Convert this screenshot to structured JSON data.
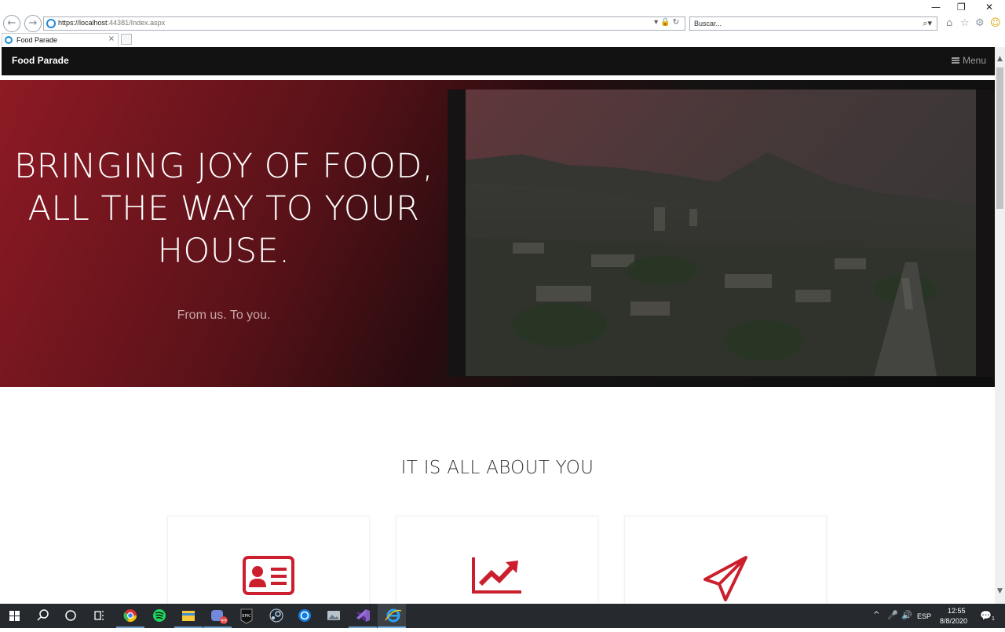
{
  "browser": {
    "url_host": "https://localhost",
    "url_rest": ":44381/Index.aspx",
    "search_placeholder": "Buscar...",
    "tab_title": "Food Parade",
    "back_glyph": "←",
    "forward_glyph": "→",
    "url_tools": "▾🔒↻",
    "search_tools": "⌕▾",
    "tab_close_glyph": "×",
    "tools": {
      "home": "⌂",
      "favorites": "☆",
      "settings": "⚙",
      "feedback": "☺"
    },
    "window_controls": {
      "minimize": "—",
      "restore": "❐",
      "close": "✕"
    }
  },
  "site": {
    "brand": "Food Parade",
    "menu_label": "Menu",
    "hero": {
      "title": "BRINGING JOY OF FOOD, ALL THE WAY TO YOUR HOUSE.",
      "subtitle": "From us. To you."
    },
    "section_title": "IT IS ALL ABOUT YOU",
    "cards": [
      {
        "icon": "id-card-icon"
      },
      {
        "icon": "chart-line-icon"
      },
      {
        "icon": "paper-plane-icon"
      }
    ],
    "accent_color": "#cc1f2d"
  },
  "scrollbar": {
    "up_glyph": "▲",
    "down_glyph": "▼"
  },
  "taskbar": {
    "apps": [
      "start",
      "search",
      "cortana",
      "task-view",
      "chrome",
      "spotify",
      "file-explorer",
      "discord",
      "epic-games",
      "steam",
      "uplay",
      "photos",
      "visual-studio",
      "internet-explorer"
    ],
    "epic_label": "EPIC",
    "discord_badge": "99",
    "tray_chevron": "^",
    "mic_glyph": "🎤",
    "volume_glyph": "🔊",
    "language": "ESP",
    "time": "12:55",
    "date": "8/8/2020",
    "notification_glyph": "💬",
    "notification_count": "1"
  }
}
